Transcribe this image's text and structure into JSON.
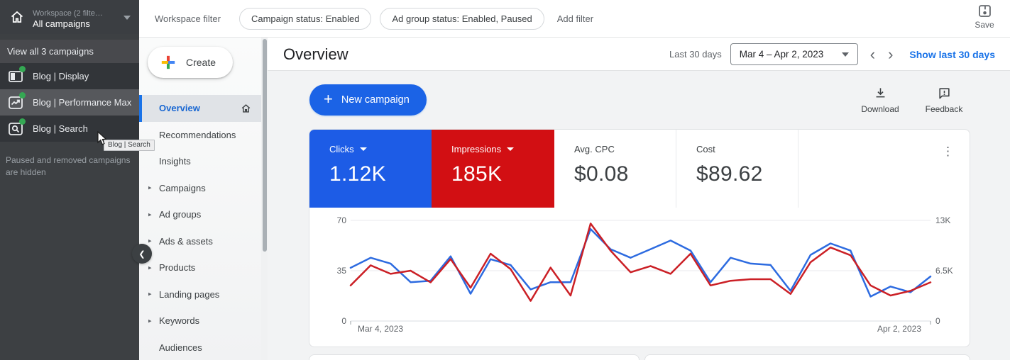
{
  "icons": {
    "expand_arrow": "▸",
    "kebab": "⋮",
    "chevron_left": "‹",
    "chevron_right": "›",
    "chevron_collapse": "❮"
  },
  "workspace_sidebar": {
    "title": "Workspace (2 filte…",
    "subtitle": "All campaigns",
    "view_all": "View all 3 campaigns",
    "campaigns": [
      {
        "label": "Blog | Display"
      },
      {
        "label": "Blog | Performance Max"
      },
      {
        "label": "Blog | Search"
      }
    ],
    "tooltip": "Blog | Search",
    "hidden_note": "Paused and removed campaigns are hidden"
  },
  "filter_bar": {
    "label": "Workspace filter",
    "chips": [
      {
        "label": "Campaign status: Enabled"
      },
      {
        "label": "Ad group status: Enabled, Paused"
      }
    ],
    "add_filter": "Add filter",
    "save_label": "Save"
  },
  "nav": {
    "create_label": "Create",
    "items": [
      {
        "label": "Overview",
        "selected": true
      },
      {
        "label": "Recommendations"
      },
      {
        "label": "Insights"
      },
      {
        "label": "Campaigns",
        "expandable": true
      },
      {
        "label": "Ad groups",
        "expandable": true
      },
      {
        "label": "Ads & assets",
        "expandable": true
      },
      {
        "label": "Products",
        "expandable": true
      },
      {
        "label": "Landing pages",
        "expandable": true
      },
      {
        "label": "Keywords",
        "expandable": true
      },
      {
        "label": "Audiences"
      }
    ]
  },
  "header": {
    "title": "Overview",
    "range_label": "Last 30 days",
    "date_range": "Mar 4 – Apr 2, 2023",
    "show_last_link": "Show last 30 days"
  },
  "toolbar": {
    "new_campaign": "New campaign",
    "plus": "+",
    "download": "Download",
    "feedback": "Feedback"
  },
  "scorecards": [
    {
      "label": "Clicks",
      "value": "1.12K",
      "selected": true,
      "color": "#1d5ce6"
    },
    {
      "label": "Impressions",
      "value": "185K",
      "selected": true,
      "color": "#d20f13"
    },
    {
      "label": "Avg. CPC",
      "value": "$0.08",
      "selected": false
    },
    {
      "label": "Cost",
      "value": "$89.62",
      "selected": false
    }
  ],
  "chart_data": {
    "type": "line",
    "title": "Clicks and Impressions, last 30 days",
    "x_start_label": "Mar 4, 2023",
    "x_end_label": "Apr 2, 2023",
    "grid": true,
    "legend_position": "none",
    "left_axis": {
      "name": "Clicks",
      "min": 0,
      "max": 70,
      "ticks": [
        "0",
        "35",
        "70"
      ]
    },
    "right_axis": {
      "name": "Impressions",
      "min": 0,
      "max": 13000,
      "ticks": [
        "0",
        "6.5K",
        "13K"
      ]
    },
    "series": [
      {
        "name": "Clicks",
        "axis": "left",
        "color": "#2d6be0",
        "values": [
          37,
          44,
          40,
          27,
          28,
          45,
          19,
          43,
          39,
          22,
          27,
          27,
          64,
          50,
          44,
          50,
          56,
          49,
          27,
          44,
          40,
          39,
          21,
          46,
          54,
          49,
          17,
          24,
          20,
          31
        ]
      },
      {
        "name": "Impressions",
        "axis": "right",
        "color": "#cb2026",
        "values": [
          4600,
          7200,
          6100,
          6500,
          5000,
          8000,
          4300,
          8700,
          6700,
          2600,
          6900,
          3300,
          12600,
          9100,
          6300,
          7100,
          6100,
          8700,
          4600,
          5200,
          5400,
          5400,
          3500,
          7600,
          9500,
          8500,
          4600,
          3300,
          3900,
          5000
        ]
      }
    ]
  }
}
